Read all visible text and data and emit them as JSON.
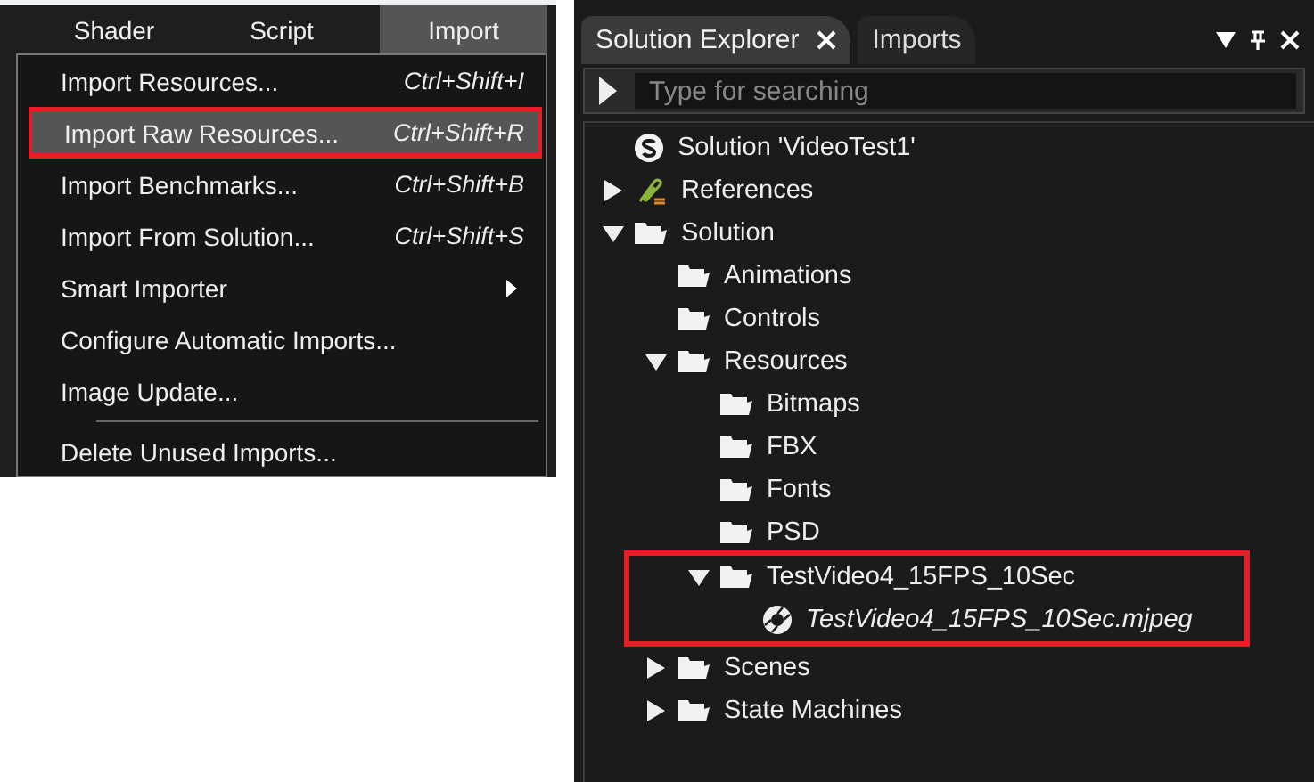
{
  "menu_bar": {
    "items": [
      {
        "label": "Shader",
        "selected": false
      },
      {
        "label": "Script",
        "selected": false
      },
      {
        "label": "Import",
        "selected": true
      }
    ]
  },
  "import_menu": {
    "items": [
      {
        "kind": "command",
        "label": "Import Resources...",
        "shortcut": "Ctrl+Shift+I",
        "selected": false,
        "annotated": false
      },
      {
        "kind": "command",
        "label": "Import Raw Resources...",
        "shortcut": "Ctrl+Shift+R",
        "selected": true,
        "annotated": true
      },
      {
        "kind": "command",
        "label": "Import Benchmarks...",
        "shortcut": "Ctrl+Shift+B",
        "selected": false,
        "annotated": false
      },
      {
        "kind": "command",
        "label": "Import From Solution...",
        "shortcut": "Ctrl+Shift+S",
        "selected": false,
        "annotated": false
      },
      {
        "kind": "submenu",
        "label": "Smart Importer",
        "selected": false,
        "annotated": false
      },
      {
        "kind": "command",
        "label": "Configure Automatic Imports...",
        "selected": false,
        "annotated": false
      },
      {
        "kind": "command",
        "label": "Image Update...",
        "selected": false,
        "annotated": false
      },
      {
        "kind": "separator"
      },
      {
        "kind": "command",
        "label": "Delete Unused Imports...",
        "selected": false,
        "annotated": false
      }
    ]
  },
  "panel": {
    "tabs": [
      {
        "label": "Solution Explorer",
        "selected": true,
        "closable": true
      },
      {
        "label": "Imports",
        "selected": false,
        "closable": false
      }
    ],
    "search": {
      "placeholder": "Type for searching"
    },
    "tree": [
      {
        "kind": "solution",
        "label": "Solution 'VideoTest1'"
      },
      {
        "kind": "references",
        "label": "References",
        "expanded": false
      },
      {
        "kind": "folder",
        "label": "Solution",
        "expanded": true,
        "children": [
          {
            "kind": "folder",
            "label": "Animations"
          },
          {
            "kind": "folder",
            "label": "Controls"
          },
          {
            "kind": "folder",
            "label": "Resources",
            "expanded": true,
            "children": [
              {
                "kind": "folder",
                "label": "Bitmaps"
              },
              {
                "kind": "folder",
                "label": "FBX"
              },
              {
                "kind": "folder",
                "label": "Fonts"
              },
              {
                "kind": "folder",
                "label": "PSD"
              },
              {
                "kind": "folder",
                "label": "TestVideo4_15FPS_10Sec",
                "expanded": true,
                "annotated": true,
                "children": [
                  {
                    "kind": "video",
                    "label": "TestVideo4_15FPS_10Sec.mjpeg"
                  }
                ]
              }
            ]
          },
          {
            "kind": "folder",
            "label": "Scenes",
            "expanded": false
          },
          {
            "kind": "folder",
            "label": "State Machines",
            "expanded": false
          }
        ]
      }
    ]
  }
}
